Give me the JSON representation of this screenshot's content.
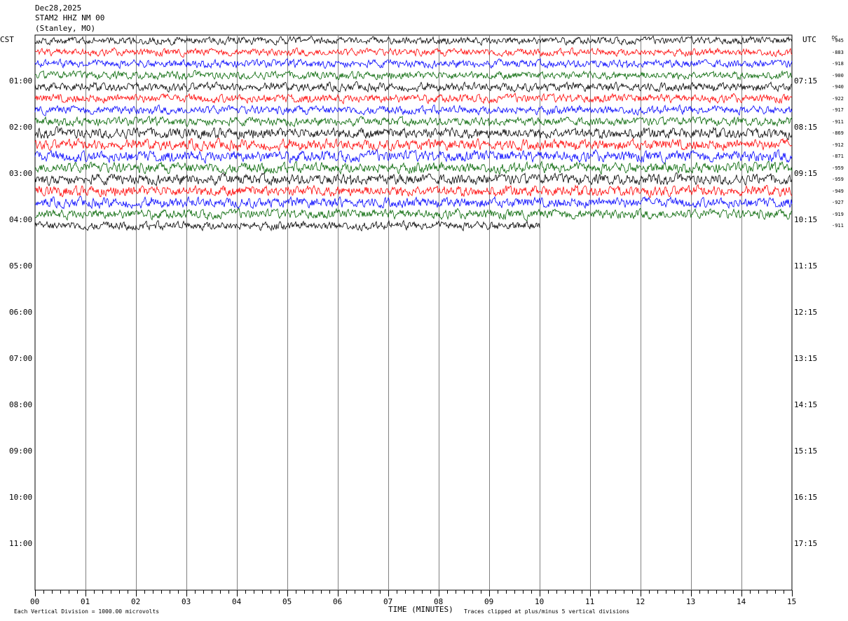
{
  "header": {
    "date": "Dec28,2025",
    "station": "STAM2 HHZ NM 00",
    "location": "(Stanley, MO)"
  },
  "left_tz": "CST",
  "right_tz": "UTC",
  "dc_label": "DC",
  "footer": {
    "division": "Each Vertical Division = 1000.00 microvolts",
    "clip": "Traces clipped at plus/minus 5 vertical divisions"
  },
  "chart_data": {
    "type": "line",
    "title": "",
    "xlabel": "TIME (MINUTES)",
    "xlim": [
      0,
      15
    ],
    "x_ticks": [
      "00",
      "01",
      "02",
      "03",
      "04",
      "05",
      "06",
      "07",
      "08",
      "09",
      "10",
      "11",
      "12",
      "13",
      "14",
      "15"
    ],
    "left_hour_labels": [
      "01:00",
      "02:00",
      "03:00",
      "04:00",
      "05:00",
      "06:00",
      "07:00",
      "08:00",
      "09:00",
      "10:00",
      "11:00"
    ],
    "right_hour_labels": [
      "07:15",
      "08:15",
      "09:15",
      "10:15",
      "11:15",
      "12:15",
      "13:15",
      "14:15",
      "15:15",
      "16:15",
      "17:15"
    ],
    "dc_offsets": [
      "-945",
      "-883",
      "-918",
      "-900",
      "-940",
      "-922",
      "-917",
      "-911",
      "-869",
      "-912",
      "-871",
      "-959",
      "-959",
      "-949",
      "-927",
      "-919",
      "-911"
    ],
    "trace_colors": [
      "#000000",
      "#ff0000",
      "#0000ff",
      "#006400"
    ],
    "traces_per_hour": 4,
    "total_hours": 12,
    "recorded_traces": 17,
    "last_trace_end_minute": 10.0,
    "amplitude_profile": [
      0.7,
      0.7,
      0.75,
      0.75,
      0.8,
      0.8,
      0.8,
      0.8,
      1.0,
      1.0,
      1.05,
      1.0,
      1.0,
      1.0,
      0.95,
      0.9,
      0.8
    ],
    "grid": true
  }
}
